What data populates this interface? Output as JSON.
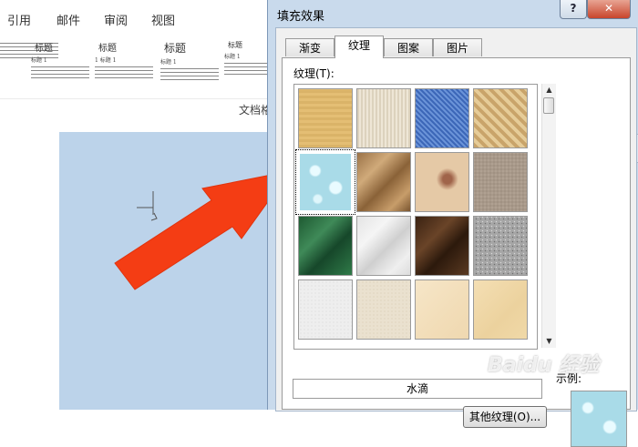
{
  "ribbon": {
    "tabs": [
      "引用",
      "邮件",
      "审阅",
      "视图"
    ]
  },
  "styles_gallery": {
    "items": [
      {
        "title": "",
        "heading": ""
      },
      {
        "title": "标题",
        "heading": "标题 1"
      },
      {
        "title": "标题",
        "heading": "1  标题 1"
      },
      {
        "title": "标题",
        "heading": "标题 1"
      },
      {
        "title": "标题",
        "heading": "标题 1"
      }
    ]
  },
  "document": {
    "label": "文档格"
  },
  "dialog": {
    "title": "填充效果",
    "help_label": "?",
    "close_label": "✕",
    "tabs": [
      {
        "label": "渐变",
        "active": false
      },
      {
        "label": "纹理",
        "active": true
      },
      {
        "label": "图案",
        "active": false
      },
      {
        "label": "图片",
        "active": false
      }
    ],
    "texture_label": "纹理(T):",
    "selected_texture_name": "水滴",
    "other_textures_button": "其他纹理(O)...",
    "sample_label": "示例:",
    "textures": [
      {
        "name": "纸莎草纸",
        "icon": "papyrus-texture"
      },
      {
        "name": "画布",
        "icon": "canvas-texture"
      },
      {
        "name": "斜纹布",
        "icon": "denim-texture"
      },
      {
        "name": "编织物",
        "icon": "woven-mat-texture"
      },
      {
        "name": "水滴",
        "icon": "water-droplets-texture",
        "selected": true
      },
      {
        "name": "纸袋",
        "icon": "paper-bag-texture"
      },
      {
        "name": "鱼类化石",
        "icon": "fish-fossil-texture"
      },
      {
        "name": "沙滩",
        "icon": "sand-texture"
      },
      {
        "name": "绿色大理石",
        "icon": "green-marble-texture"
      },
      {
        "name": "白色大理石",
        "icon": "white-marble-texture"
      },
      {
        "name": "褐色大理石",
        "icon": "brown-marble-texture"
      },
      {
        "name": "花岗岩",
        "icon": "granite-texture"
      },
      {
        "name": "新闻纸",
        "icon": "newsprint-texture"
      },
      {
        "name": "再生纸",
        "icon": "recycled-paper-texture"
      },
      {
        "name": "羊皮纸",
        "icon": "parchment-texture"
      },
      {
        "name": "信纸",
        "icon": "stationery-texture"
      }
    ]
  },
  "watermark": {
    "text": "Baidu 经验"
  }
}
